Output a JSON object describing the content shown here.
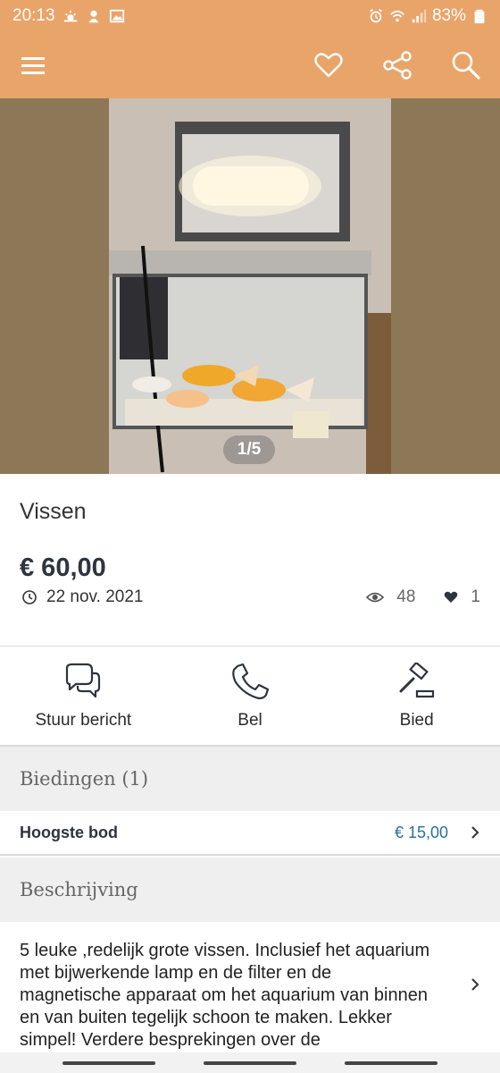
{
  "status_bar": {
    "time": "20:13",
    "battery": "83%",
    "bg_color": "#e9a46a"
  },
  "app_bar": {
    "icons": [
      "menu-icon",
      "heart-icon",
      "share-icon",
      "search-icon"
    ]
  },
  "gallery": {
    "counter": "1/5"
  },
  "listing": {
    "title": "Vissen",
    "price": "€ 60,00",
    "date": "22 nov. 2021",
    "views": "48",
    "likes": "1"
  },
  "actions": {
    "message_label": "Stuur bericht",
    "call_label": "Bel",
    "bid_label": "Bied"
  },
  "bids": {
    "header": "Biedingen (1)",
    "highest_label": "Hoogste bod",
    "highest_value": "€ 15,00"
  },
  "description": {
    "header": "Beschrijving",
    "text": "5 leuke ,redelijk grote vissen. Inclusief het aquarium met bijwerkende lamp en de filter en de magnetische apparaat om het aquarium van binnen en van buiten tegelijk schoon te maken. Lekker simpel! Verdere besprekingen over de"
  },
  "colors": {
    "accent": "#e9a46a",
    "price_blue": "#2a6ea3",
    "section_bg": "#efefef"
  }
}
